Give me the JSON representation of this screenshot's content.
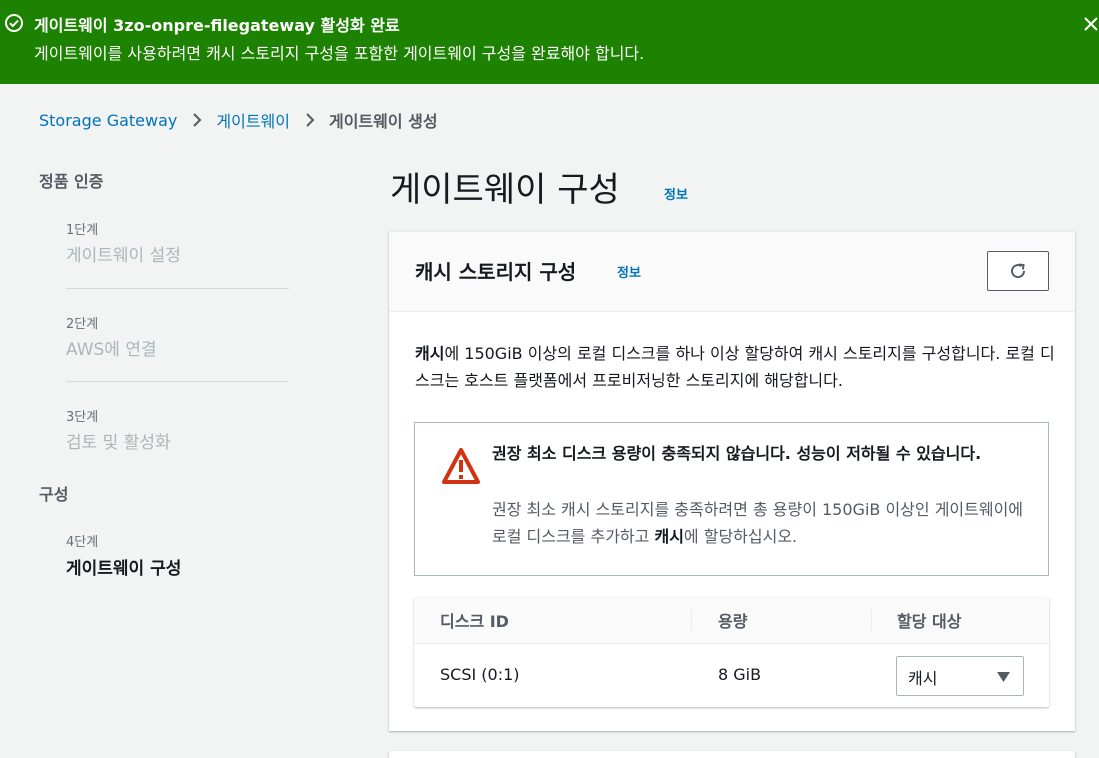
{
  "flash": {
    "title": "게이트웨이 3zo-onpre-filegateway 활성화 완료",
    "description": "게이트웨이를 사용하려면 캐시 스토리지 구성을 포함한 게이트웨이 구성을 완료해야 합니다.",
    "color": "#1d8102"
  },
  "breadcrumb": {
    "items": [
      "Storage Gateway",
      "게이트웨이"
    ],
    "current": "게이트웨이 생성"
  },
  "nav": {
    "section1": "정품 인증",
    "section2": "구성",
    "steps": [
      {
        "label": "1단계",
        "title": "게이트웨이 설정"
      },
      {
        "label": "2단계",
        "title": "AWS에 연결"
      },
      {
        "label": "3단계",
        "title": "검토 및 활성화"
      },
      {
        "label": "4단계",
        "title": "게이트웨이 구성"
      }
    ]
  },
  "page": {
    "title": "게이트웨이 구성",
    "info": "정보"
  },
  "panel": {
    "title": "캐시 스토리지 구성",
    "info": "정보",
    "text_bold": "캐시",
    "text_rest": "에 150GiB 이상의 로컬 디스크를 하나 이상 할당하여 캐시 스토리지를 구성합니다. 로컬 디스크는 호스트 플랫폼에서 프로비저닝한 스토리지에 해당합니다."
  },
  "alert": {
    "title": "권장 최소 디스크 용량이 충족되지 않습니다. 성능이 저하될 수 있습니다.",
    "body_part1": "권장 최소 캐시 스토리지를 충족하려면 총 용량이 150GiB 이상인 게이트웨이에 로컬 디스크를 추가하고 ",
    "body_bold": "캐시",
    "body_part2": "에 할당하십시오."
  },
  "table": {
    "columns": [
      "디스크 ID",
      "용량",
      "할당 대상"
    ],
    "rows": [
      {
        "disk_id": "SCSI (0:1)",
        "capacity": "8 GiB",
        "allocation": "캐시"
      }
    ]
  },
  "colors": {
    "link": "#0073bb",
    "warning": "#d13212"
  }
}
